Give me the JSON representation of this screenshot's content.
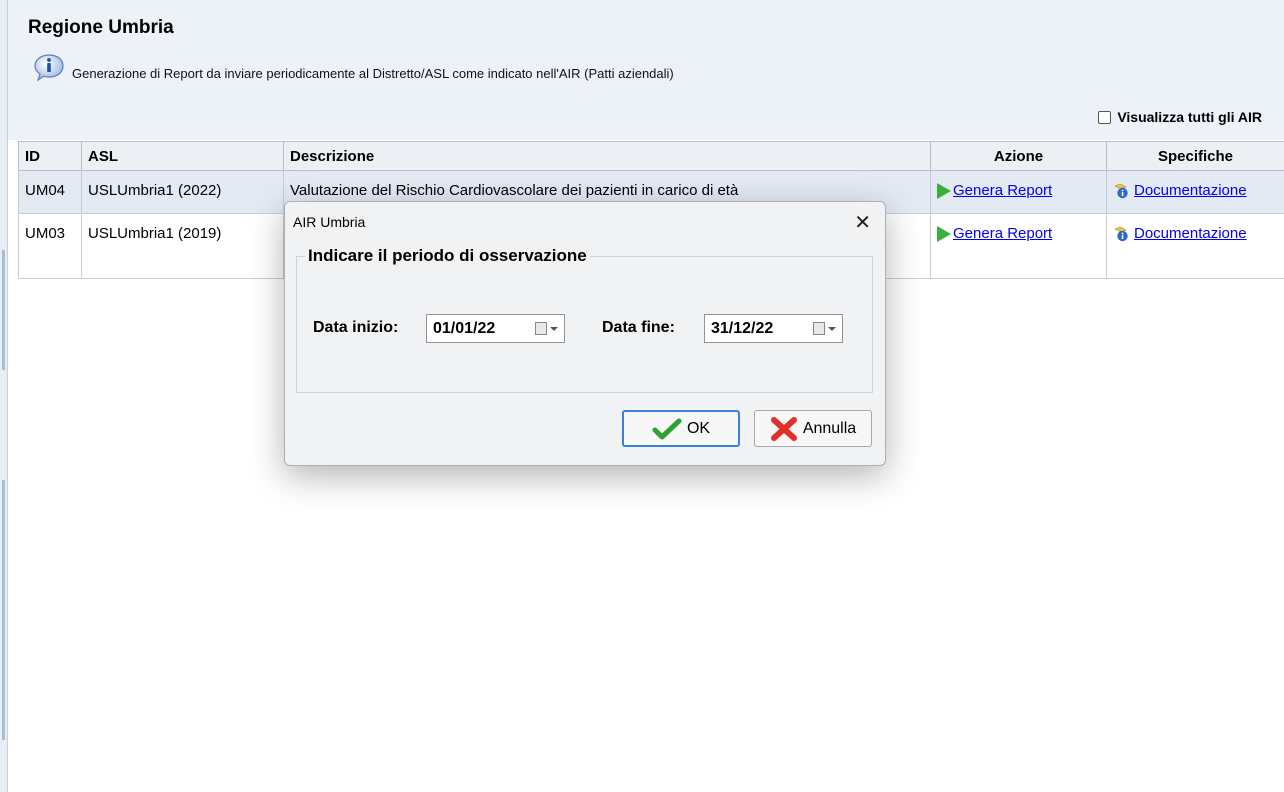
{
  "header": {
    "title": "Regione Umbria",
    "info_text": "Generazione di Report da inviare periodicamente al Distretto/ASL come indicato nell'AIR (Patti aziendali)",
    "show_all_label": "Visualizza tutti gli AIR"
  },
  "table": {
    "columns": [
      "ID",
      "ASL",
      "Descrizione",
      "Azione",
      "Specifiche"
    ],
    "rows": [
      {
        "id": "UM04",
        "asl": "USLUmbria1 (2022)",
        "descrizione": "Valutazione del Rischio Cardiovascolare dei pazienti in carico di età",
        "azione": "Genera Report",
        "specifiche": "Documentazione"
      },
      {
        "id": "UM03",
        "asl": "USLUmbria1 (2019)",
        "descrizione": "",
        "azione": "Genera Report",
        "specifiche": "Documentazione"
      }
    ]
  },
  "dialog": {
    "title": "AIR Umbria",
    "close": "✕",
    "group_label": "Indicare il periodo di osservazione",
    "start_label": "Data inizio:",
    "start_value": "01/01/22",
    "end_label": "Data fine:",
    "end_value": "31/12/22",
    "ok_label": "OK",
    "cancel_label": "Annulla"
  },
  "colors": {
    "header_bg": "#edf2f8",
    "selected_row_bg": "#e3eaf3",
    "link": "#0000ee",
    "ok_border": "#3b82d6"
  },
  "icons": [
    "info-icon",
    "play-icon",
    "documentation-icon",
    "calendar-icon",
    "checkmark-icon",
    "red-x-icon",
    "close-icon"
  ]
}
